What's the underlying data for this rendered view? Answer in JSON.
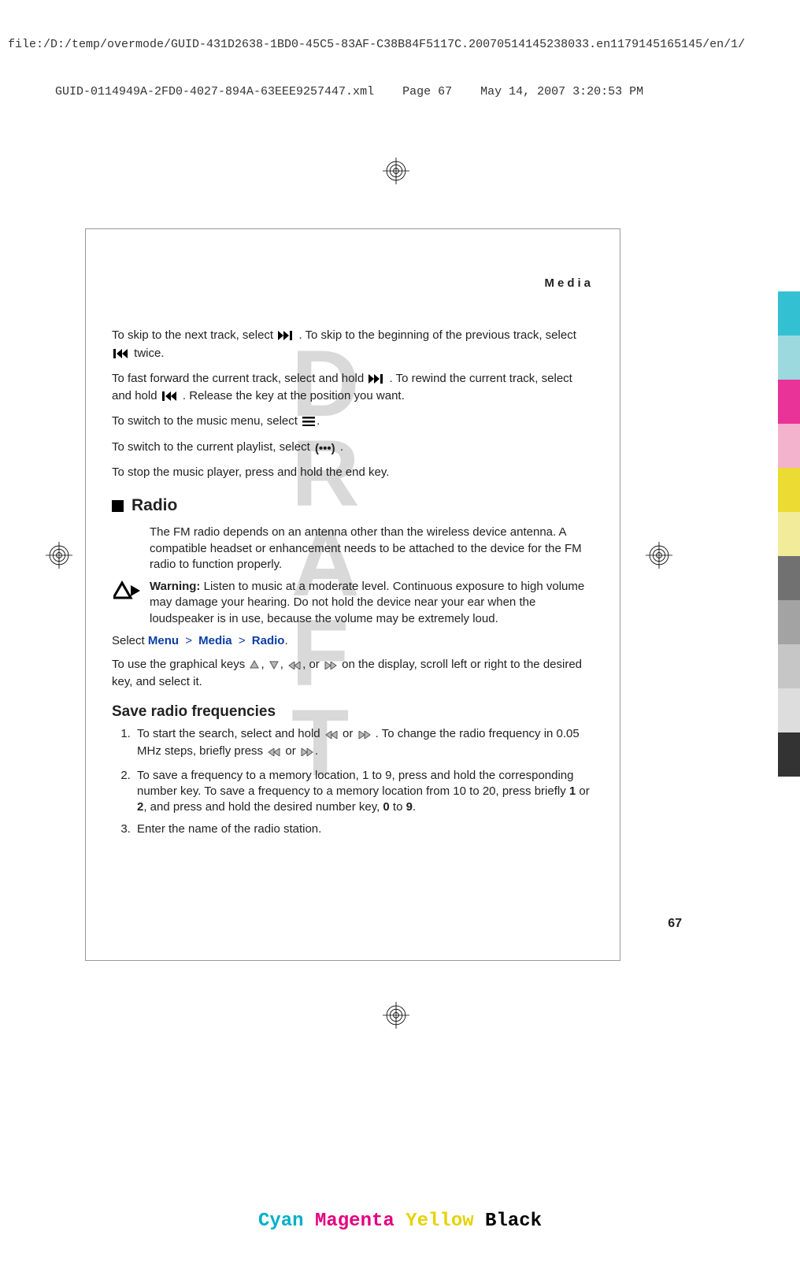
{
  "meta": {
    "path_line": "file:/D:/temp/overmode/GUID-431D2638-1BD0-45C5-83AF-C38B84F5117C.20070514145238033.en1179145165145/en/1/",
    "guid_line": "GUID-0114949A-2FD0-4027-894A-63EEE9257447.xml    Page 67    May 14, 2007 3:20:53 PM"
  },
  "running_head": "Media",
  "watermark": "DRAFT",
  "paragraphs": {
    "p1a": "To skip to the next track, select ",
    "p1b": ". To skip to the beginning of the previous track, select",
    "p1c": " twice.",
    "p2a": "To fast forward the current track, select and hold ",
    "p2b": ". To rewind the current track, select and hold ",
    "p2c": ". Release the key at the position you want.",
    "p3": "To switch to the music menu, select ",
    "p4": "To switch to the current playlist, select ",
    "p5": "To stop the music player, press and hold the end key."
  },
  "section_title": "Radio",
  "radio_intro": "The FM radio depends on an antenna other than the wireless device antenna. A compatible headset or enhancement needs to be attached to the device for the FM radio to function properly.",
  "warning_label": "Warning:",
  "warning_text": " Listen to music at a moderate level. Continuous exposure to high volume may damage your hearing. Do not hold the device near your ear when the loudspeaker is in use, because the volume may be extremely loud.",
  "nav": {
    "select": "Select ",
    "menu": "Menu",
    "media": "Media",
    "radio": "Radio"
  },
  "keys_line_a": "To use the graphical keys ",
  "keys_line_b": " on the display, scroll left or right to the desired key, and select it.",
  "sub_head": "Save radio frequencies",
  "steps": {
    "s1a": "To start the search, select and hold ",
    "s1b": ". To change the radio frequency in 0.05 MHz steps, briefly press ",
    "s2a": "To save a frequency to a memory location, 1 to 9, press and hold the corresponding number key. To save a frequency to a memory location from 10 to 20, press briefly ",
    "s2_or": " or ",
    "s2b": ", and press and hold the desired number key, ",
    "s2_to": " to ",
    "s3": "Enter the name of the radio station."
  },
  "bold": {
    "one": "1",
    "two": "2",
    "zero": "0",
    "nine": "9"
  },
  "page_number": "67",
  "cmyk": {
    "c": "Cyan",
    "m": "Magenta",
    "y": "Yellow",
    "k": "Black"
  },
  "colorbars": [
    "#00b0c8",
    "#83d0d6",
    "#e4007f",
    "#f0a0c0",
    "#e6d200",
    "#efe680",
    "#4e4e4e",
    "#8c8c8c",
    "#b8b8b8",
    "#d4d4d4",
    "#000000"
  ]
}
